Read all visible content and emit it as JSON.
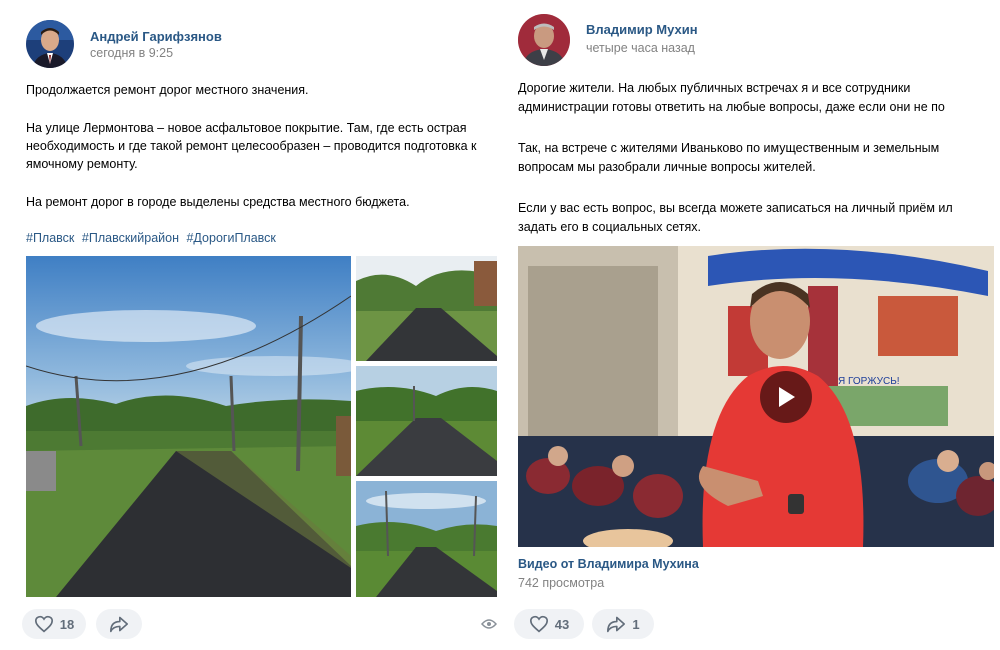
{
  "posts": [
    {
      "author": "Андрей Гарифзянов",
      "time": "сегодня в 9:25",
      "paragraphs": [
        "Продолжается ремонт дорог местного значения.",
        "На улице Лермонтова – новое асфальтовое покрытие. Там, где есть острая",
        "необходимость и где такой ремонт целесообразен – проводится подготовка к",
        "ямочному ремонту.",
        "На ремонт дорог в городе выделены средства местного бюджета."
      ],
      "hashtags": [
        "#Плавск",
        "#Плавскийрайон",
        "#ДорогиПлавск"
      ],
      "likes": "18",
      "icons": [
        "heart-icon",
        "share-icon",
        "eye-icon"
      ]
    },
    {
      "author": "Владимир Мухин",
      "time": "четыре часа назад",
      "paragraphs": [
        "Дорогие жители. На любых публичных встречах я и все сотрудники",
        "администрации готовы ответить на любые вопросы, даже если они не по",
        "Так, на встрече с жителями Иваньково по имущественным и земельным",
        "вопросам мы разобрали личные вопросы жителей.",
        "Если у вас есть вопрос, вы всегда можете записаться на личный приём ил",
        "задать его в социальных сетях."
      ],
      "video": {
        "title": "Видео от Владимира Мухина",
        "views": "742 просмотра",
        "banner_text": "Я ГОРЖУСЬ!"
      },
      "likes": "43",
      "shares": "1",
      "icons": [
        "heart-icon",
        "share-icon",
        "play-icon"
      ]
    }
  ],
  "colors": {
    "link": "#2a5885",
    "muted": "#828282",
    "button_bg": "#f0f2f5",
    "video_shirt": "#e53935"
  }
}
